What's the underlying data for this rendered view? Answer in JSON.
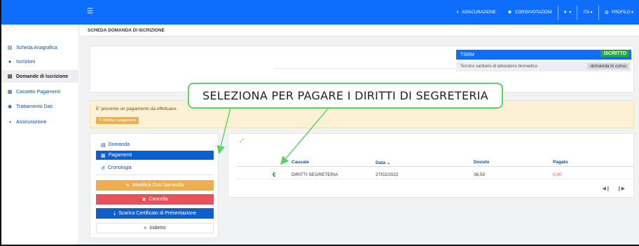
{
  "topbar": {
    "menu_icon": "hamburger-icon",
    "items": [
      {
        "icon": "shield-icon",
        "label": "ASSICURAZIONE"
      },
      {
        "icon": "users-icon",
        "label": "CORSI/VOTAZIONI"
      },
      {
        "icon": "bell-icon",
        "label": "▾"
      },
      {
        "icon": "",
        "label": "ITA ▾"
      },
      {
        "icon": "settings-icon",
        "label": "PROFILO ▾"
      }
    ]
  },
  "sidebar": {
    "items": [
      {
        "icon": "id-card-icon",
        "label": "Scheda Anagrafica"
      },
      {
        "icon": "user-icon",
        "label": "Iscrizioni"
      },
      {
        "icon": "list-icon",
        "label": "Domande di Iscrizione",
        "active": true
      },
      {
        "icon": "file-icon",
        "label": "Cassetto Pagamenti"
      },
      {
        "icon": "eye-icon",
        "label": "Trattamento Dati"
      },
      {
        "icon": "shield-icon",
        "label": "Assicurazione"
      }
    ]
  },
  "breadcrumb": "SCHEDA DOMANDA DI ISCRIZIONE",
  "profile": {
    "title": "TSRM",
    "status_badge": "ISCRITTO",
    "description": "Tecnico sanitario di laboratorio biomedico",
    "state_badge": "domanda in corso"
  },
  "alert": {
    "text": "E' presente un pagamento da effettuare.",
    "button": "Effettua il pagamento"
  },
  "callout": "SELEZIONA PER PAGARE I DIRITTI DI SEGRETERIA",
  "menu": {
    "links": [
      {
        "icon": "form-icon",
        "label": "Domanda"
      },
      {
        "icon": "file-icon",
        "label": "Pagamenti",
        "active": true
      },
      {
        "icon": "history-icon",
        "label": "Cronologia"
      }
    ],
    "buttons": {
      "modifica": "Modifica Dati Domanda",
      "cancella": "Cancella",
      "scarica": "Scarica Certificato di Presentazione",
      "indietro": "Indietro"
    }
  },
  "table": {
    "columns": [
      "Causale",
      "Data ⌄",
      "Dovuto",
      "Pagato"
    ],
    "rows": [
      {
        "currency": "€",
        "causale": "DIRITTI SEGRETERIA",
        "data": "27/02/2022",
        "dovuto": "36,50",
        "pagato": "0,00"
      }
    ]
  },
  "colors": {
    "primary": "#0d6efd",
    "success": "#28a745",
    "warning": "#f0ad4e",
    "danger": "#e9505a",
    "callout_border": "#5bd466"
  }
}
